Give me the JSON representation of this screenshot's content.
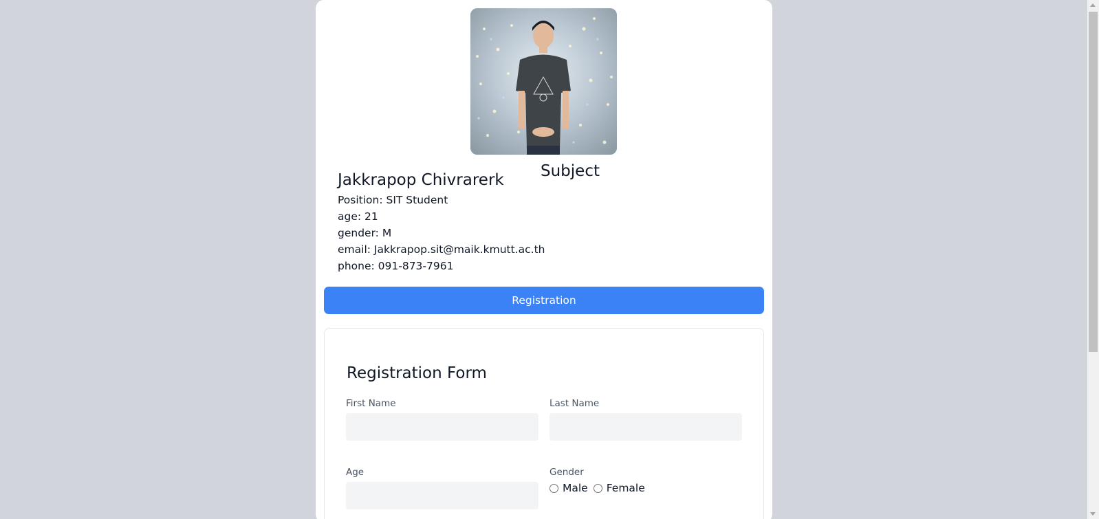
{
  "profile": {
    "name": "Jakkrapop Chivrarerk",
    "position": "Position: SIT Student",
    "age": "age: 21",
    "gender": "gender: M",
    "email": "email: Jakkrapop.sit@maik.kmutt.ac.th",
    "phone": "phone: 091-873-7961"
  },
  "subject_heading": "Subject",
  "registration_button": "Registration",
  "form": {
    "title": "Registration Form",
    "first_name_label": "First Name",
    "last_name_label": "Last Name",
    "age_label": "Age",
    "gender_label": "Gender",
    "gender_options": [
      "Male",
      "Female"
    ]
  },
  "colors": {
    "page_background": "#d1d5db",
    "accent": "#3b82f6",
    "input_background": "#f3f4f6"
  }
}
